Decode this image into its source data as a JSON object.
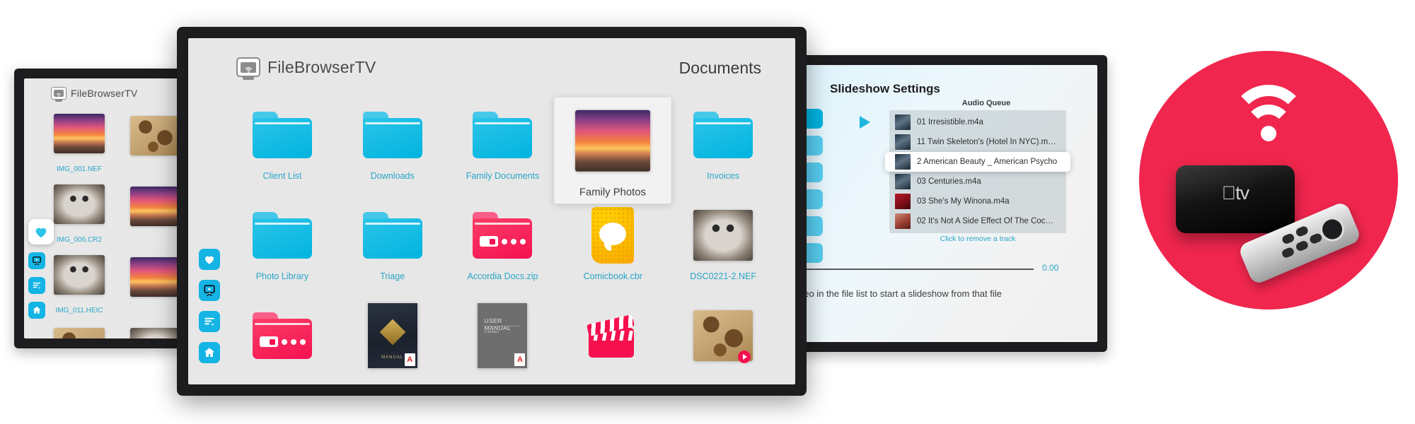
{
  "app": {
    "name": "FileBrowserTV",
    "icon": "filebrowser-tv-icon"
  },
  "main_tv": {
    "page_title": "Documents",
    "rail": [
      {
        "name": "favorites",
        "icon": "heart-icon",
        "focused": false
      },
      {
        "name": "slideshow",
        "icon": "slideshow-icon",
        "focused": false
      },
      {
        "name": "sort-list",
        "icon": "list-sort-icon",
        "focused": false
      },
      {
        "name": "home",
        "icon": "home-icon",
        "focused": false
      }
    ],
    "files": [
      {
        "label": "Client List",
        "kind": "folder",
        "color": "blue",
        "selected": false
      },
      {
        "label": "Downloads",
        "kind": "folder",
        "color": "blue",
        "selected": false
      },
      {
        "label": "Family Documents",
        "kind": "folder",
        "color": "blue",
        "selected": false
      },
      {
        "label": "Family Photos",
        "kind": "photofolder",
        "thumb": "sunset",
        "selected": true
      },
      {
        "label": "Invoices",
        "kind": "folder",
        "color": "blue",
        "selected": false
      },
      {
        "label": "Photo Library",
        "kind": "folder",
        "color": "blue",
        "selected": false
      },
      {
        "label": "Triage",
        "kind": "folder",
        "color": "blue",
        "selected": false
      },
      {
        "label": "Accordia Docs.zip",
        "kind": "zip",
        "color": "pink",
        "selected": false
      },
      {
        "label": "Comicbook.cbr",
        "kind": "comic",
        "selected": false
      },
      {
        "label": "DSC0221-2.NEF",
        "kind": "photo",
        "thumb": "owl",
        "selected": false
      },
      {
        "label": "",
        "kind": "zip",
        "color": "pink",
        "selected": false
      },
      {
        "label": "",
        "kind": "pdf-dark",
        "selected": false
      },
      {
        "label": "",
        "kind": "pdf-gray",
        "selected": false
      },
      {
        "label": "",
        "kind": "clapper",
        "selected": false
      },
      {
        "label": "",
        "kind": "photo",
        "thumb": "map",
        "play": true,
        "selected": false
      }
    ],
    "pdf_dark_caption": "MANUAL",
    "pdf_gray_caption": "USER MANUAL",
    "pdf_gray_sub": "K SERIES",
    "pdf_badge": "A"
  },
  "left_tv": {
    "rail": [
      {
        "name": "favorites",
        "icon": "heart-icon",
        "focused": true
      },
      {
        "name": "slideshow",
        "icon": "slideshow-icon",
        "focused": false
      },
      {
        "name": "sort-list",
        "icon": "list-sort-icon",
        "focused": false
      },
      {
        "name": "home",
        "icon": "home-icon",
        "focused": false
      }
    ],
    "files": [
      {
        "label": "IMG_001.NEF",
        "thumb": "sunset"
      },
      {
        "label": "",
        "thumb": "map"
      },
      {
        "label": "IMG_006.CR2",
        "thumb": "owl"
      },
      {
        "label": "",
        "thumb": "sunset"
      },
      {
        "label": "IMG_011.HEIC",
        "thumb": "owl"
      },
      {
        "label": "",
        "thumb": "sunset"
      },
      {
        "label": "",
        "thumb": "map"
      },
      {
        "label": "",
        "thumb": "owl"
      }
    ]
  },
  "slideshow": {
    "title": "Slideshow Settings",
    "queue_label": "Audio Queue",
    "tracks": [
      {
        "title": "01 Irresistible.m4a",
        "art": "art-a",
        "highlighted": false
      },
      {
        "title": "11 Twin Skeleton's (Hotel In NYC).m…",
        "art": "art-a",
        "highlighted": false
      },
      {
        "title": "2 American Beauty _ American Psycho",
        "art": "art-a",
        "highlighted": true
      },
      {
        "title": "03 Centuries.m4a",
        "art": "art-a",
        "highlighted": false
      },
      {
        "title": "03 She's My Winona.m4a",
        "art": "art-b",
        "highlighted": false
      },
      {
        "title": "02 It's Not A Side Effect Of The Coc…",
        "art": "art-c",
        "highlighted": false
      }
    ],
    "remove_hint": "Click to remove a track",
    "slider_value": "0.00",
    "footer": "deo in the file list to start a slideshow from that file"
  },
  "badge": {
    "name": "apple-tv-wifi-badge",
    "circle_color": "#f0264e",
    "device_label": "tv"
  },
  "colors": {
    "accent": "#2aa5c8",
    "folder_blue": "#00b4e0",
    "folder_pink": "#f5114f",
    "brand_red": "#f0264e"
  }
}
